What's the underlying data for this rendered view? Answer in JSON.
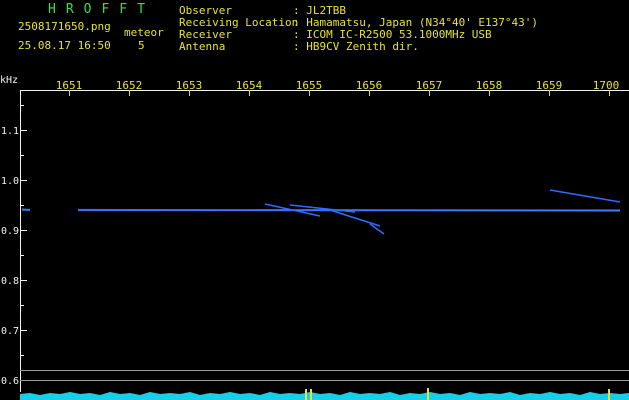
{
  "title": "HROFFT",
  "file_name": "2508171650.png",
  "datetime": "25.08.17 16:50",
  "meteor": {
    "label": "meteor",
    "count": "5"
  },
  "info": [
    {
      "key": "Observer",
      "value": ": JL2TBB"
    },
    {
      "key": "Receiving Location",
      "value": ": Hamamatsu, Japan (N34°40' E137°43')"
    },
    {
      "key": "Receiver",
      "value": ": ICOM IC-R2500 53.1000MHz USB"
    },
    {
      "key": "Antenna",
      "value": ": HB9CV Zenith dir."
    }
  ],
  "y_axis": {
    "unit": "kHz",
    "ticks": [
      "1.1",
      "1.0",
      "0.9",
      "0.8",
      "0.7",
      "0.6"
    ]
  },
  "x_axis": {
    "ticks": [
      "1651",
      "1652",
      "1653",
      "1654",
      "1655",
      "1656",
      "1657",
      "1658",
      "1659",
      "1700"
    ]
  },
  "colors": {
    "green": "#3fdc4a",
    "yellow": "#e6e23a",
    "signal": "#2a5cff",
    "cyan": "#19e6ff"
  }
}
